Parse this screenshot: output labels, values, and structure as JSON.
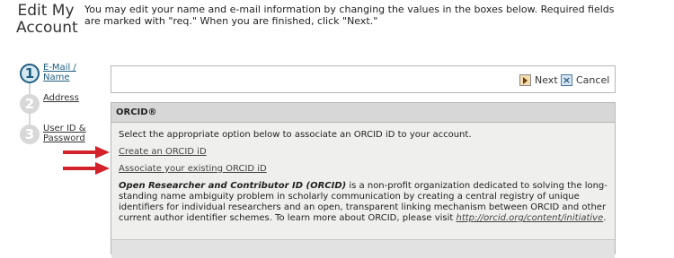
{
  "page": {
    "title": "Edit My Account",
    "intro": "You may edit your name and e-mail information by changing the values in the boxes below. Required fields are marked with \"req.\" When you are finished, click \"Next.\""
  },
  "steps": [
    {
      "number": "1",
      "label": "E-Mail / Name",
      "state": "active"
    },
    {
      "number": "2",
      "label": "Address",
      "state": "inactive"
    },
    {
      "number": "3",
      "label": "User ID & Password",
      "state": "inactive"
    }
  ],
  "toolbar": {
    "next_label": "Next",
    "cancel_label": "Cancel",
    "next_icon": "next-arrow-icon",
    "cancel_icon": "cancel-x-icon"
  },
  "orcid_panel": {
    "header": "ORCID®",
    "instruction": "Select the appropriate option below to associate an ORCID iD to your account.",
    "create_link": "Create an ORCID iD",
    "associate_link": "Associate your existing ORCID iD",
    "description_bold": "Open Researcher and Contributor ID (ORCID)",
    "description_text": " is a non-profit organization dedicated to solving the long-standing name ambiguity problem in scholarly communication by creating a central registry of unique identifiers for individual researchers and an open, transparent linking mechanism between ORCID and other current author identifier schemes. To learn more about ORCID, please visit ",
    "description_url": "http://orcid.org/content/initiative",
    "description_end": "."
  },
  "colors": {
    "annotation_arrow": "#d3222a",
    "active_step": "#1f5e80",
    "panel_header": "#d7d7d7"
  }
}
